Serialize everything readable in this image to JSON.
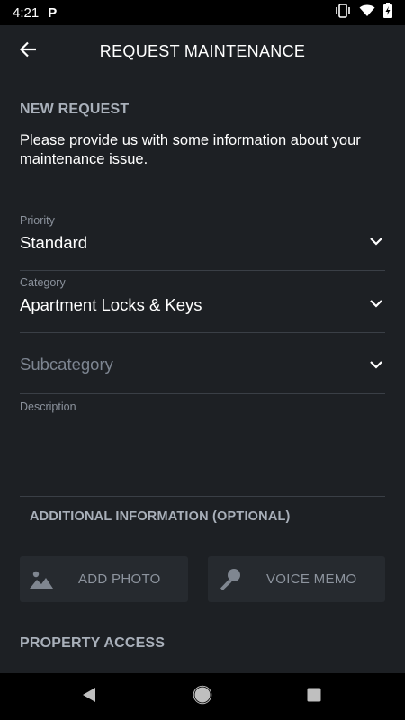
{
  "status_bar": {
    "time": "4:21",
    "app_indicator": "P",
    "icons": [
      "vibrate-icon",
      "wifi-icon",
      "battery-charging-icon"
    ]
  },
  "app_bar": {
    "title": "REQUEST MAINTENANCE",
    "back_icon": "arrow-left-icon"
  },
  "new_request": {
    "heading": "NEW REQUEST",
    "intro": "Please provide us with some information about your maintenance issue."
  },
  "form": {
    "priority": {
      "label": "Priority",
      "value": "Standard"
    },
    "category": {
      "label": "Category",
      "value": "Apartment Locks & Keys"
    },
    "subcategory": {
      "placeholder": "Subcategory"
    },
    "description": {
      "label": "Description",
      "value": ""
    }
  },
  "additional_info": {
    "heading": "ADDITIONAL INFORMATION (OPTIONAL)",
    "add_photo": "ADD PHOTO",
    "voice_memo": "VOICE MEMO"
  },
  "property_access": {
    "heading": "PROPERTY ACCESS"
  },
  "colors": {
    "background": "#1d2024",
    "label": "#a9b0ba",
    "divider": "#3a3f46",
    "button_bg": "#262a2f"
  }
}
